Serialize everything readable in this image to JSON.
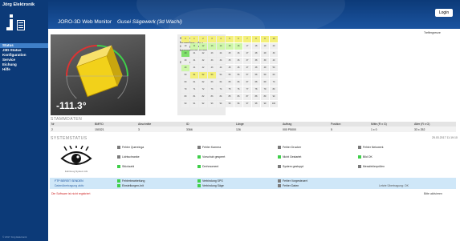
{
  "brand": "Jörg Elektronik",
  "header": {
    "title": "JORO-3D Web Monitor",
    "subtitle": "Gusei Sägewerk (3d Wachi)",
    "login_label": "Login"
  },
  "nav": [
    {
      "label": "Status",
      "active": true
    },
    {
      "label": "J3D-Status",
      "active": false
    },
    {
      "label": "Konfiguration",
      "active": false
    },
    {
      "label": "Service",
      "active": false
    },
    {
      "label": "Eichung",
      "active": false
    },
    {
      "label": "Hilfe",
      "active": false
    }
  ],
  "top_link": "Treffergrenze",
  "gauge": {
    "value": "-111.3°"
  },
  "info": {
    "lines": [
      "Stämme",
      "Messanlage: Teil 1",
      "Holzgruppe: x x 5",
      "Messmethode: Boden",
      "Durchlauf: 1"
    ]
  },
  "grid": {
    "header": [
      "0",
      "1",
      "2",
      "3",
      "4",
      "5",
      "6",
      "7",
      "8",
      "9",
      "10",
      "11"
    ],
    "rows": [
      [
        "10",
        "11",
        "12",
        "13",
        "14",
        "15",
        "16",
        "17",
        "18",
        "19",
        "20"
      ],
      [
        "20",
        "21",
        "22",
        "23",
        "24",
        "25",
        "26",
        "27",
        "28",
        "29",
        "30"
      ],
      [
        "30",
        "31",
        "32",
        "33",
        "34",
        "35",
        "36",
        "37",
        "38",
        "39",
        "40"
      ],
      [
        "40",
        "41",
        "42",
        "43",
        "44",
        "45",
        "46",
        "47",
        "48",
        "49",
        "50"
      ],
      [
        "50",
        "51",
        "52",
        "53",
        "54",
        "55",
        "56",
        "57",
        "58",
        "59",
        "60"
      ],
      [
        "60",
        "61",
        "62",
        "63",
        "64",
        "65",
        "66",
        "67",
        "68",
        "69",
        "70"
      ],
      [
        "70",
        "71",
        "72",
        "73",
        "74",
        "75",
        "76",
        "77",
        "78",
        "79",
        "80"
      ],
      [
        "80",
        "81",
        "82",
        "83",
        "84",
        "85",
        "86",
        "87",
        "88",
        "89",
        "90"
      ],
      [
        "90",
        "91",
        "92",
        "93",
        "94",
        "95",
        "96",
        "97",
        "98",
        "99",
        "100"
      ]
    ]
  },
  "stammdaten": {
    "title": "STAMMDATEN",
    "headers": [
      "Nr",
      "BMFID",
      "Abschnitte",
      "ID",
      "Länge",
      "Auftrag",
      "Position",
      "Mitte (R x G)",
      "Alter (R x G)"
    ],
    "values": [
      "2",
      "150321",
      "3",
      "3366",
      "126",
      "000 P5000",
      "5",
      "1 x 0",
      "33 x 252"
    ]
  },
  "systemstatus": {
    "title": "SYSTEMSTATUS",
    "date": "25.03.2017 11:19:10",
    "eye_text": "Fahrzeug System AG",
    "row1": [
      {
        "label": "Fehler Quereinga",
        "color": "#7b7b7b"
      },
      {
        "label": "Fehler Kamera",
        "color": "#7b7b7b"
      },
      {
        "label": "Fehler Drucker",
        "color": "#7b7b7b"
      },
      {
        "label": "Fehler Netzwerk",
        "color": "#7b7b7b"
      }
    ],
    "row2": [
      {
        "label": "Lichtschranke",
        "color": "#7b7b7b"
      },
      {
        "label": "Vorschub gesperrt",
        "color": "#3fcf4a"
      },
      {
        "label": "Nicht Gestartet",
        "color": "#3fcf4a"
      },
      {
        "label": "Bild OK",
        "color": "#3fcf4a"
      }
    ],
    "row3": [
      {
        "label": "Stückzahl",
        "color": "#3fcf4a"
      },
      {
        "label": "Drehmoment",
        "color": "#3fcf4a"
      },
      {
        "label": "System gestoppt",
        "color": "#7b7b7b"
      },
      {
        "label": "Messfehlerprüfen",
        "color": "#7b7b7b"
      }
    ],
    "blue1": [
      {
        "label": "Fehlerbearbeitung",
        "color": "#3fcf4a"
      },
      {
        "label": "Verbindung SPS",
        "color": "#3fcf4a"
      },
      {
        "label": "Fehler Vorgesteuert",
        "color": "#7b7b7b"
      }
    ],
    "blue2": [
      {
        "label": "Einstellungen-Init",
        "color": "#3fcf4a"
      },
      {
        "label": "Verbindung Säge",
        "color": "#3fcf4a"
      },
      {
        "label": "Fehler Daten",
        "color": "#7b7b7b"
      }
    ],
    "blue_left1": "FTP BEREIT SENDEN",
    "blue_left2": "Datenübertragung aktiv",
    "blue_right": "Letzte Übertragung: OK",
    "red_note": "Die Software ist nicht registriert",
    "right_note": "Bitte aktivieren"
  },
  "footer": "© 2017 Jörg Elektronik",
  "colors": {
    "header_bg": "#0c3a78",
    "green": "#3fcf4a",
    "yellow": "#f4f07a",
    "gauge_red": "#d33"
  }
}
